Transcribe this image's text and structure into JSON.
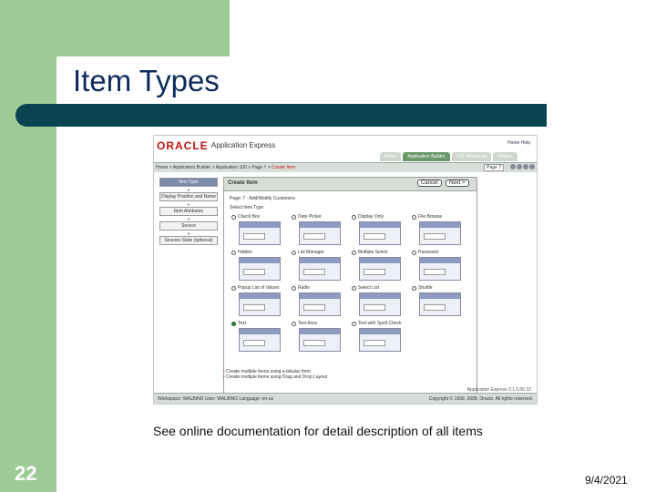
{
  "slide": {
    "title": "Item Types",
    "caption": "See online documentation for detail description of all items",
    "page_number": "22",
    "date": "9/4/2021",
    "colors": {
      "side_green": "#9ccb96",
      "title_bar": "#0b4451",
      "title_text": "#0d2b5a"
    }
  },
  "screenshot": {
    "brand": "ORACLE",
    "product": "Application Express",
    "top_links": [
      "Home",
      "Help"
    ],
    "tabs": [
      {
        "label": "Home",
        "active": false
      },
      {
        "label": "Application Builder",
        "active": true
      },
      {
        "label": "SQL Workshop",
        "active": false
      },
      {
        "label": "Utilities",
        "active": false
      }
    ],
    "breadcrumb": "Home > Application Builder > Application 100 > Page 7 >",
    "breadcrumb_current": "Create Item",
    "page_selector": "Page 7",
    "wizard_steps": [
      {
        "label": "Item Type",
        "current": true
      },
      {
        "label": "Display Position and Name",
        "current": false
      },
      {
        "label": "Item Attributes",
        "current": false
      },
      {
        "label": "Source",
        "current": false
      },
      {
        "label": "Session State (optional)",
        "current": false
      }
    ],
    "panel_title": "Create Item",
    "cancel_label": "Cancel",
    "next_label": "Next >",
    "page_info": "Page: 7 - Add/Modify Customers",
    "select_label": "Select Item Type",
    "item_types": [
      {
        "label": "Check Box",
        "selected": false
      },
      {
        "label": "Date Picker",
        "selected": false
      },
      {
        "label": "Display Only",
        "selected": false
      },
      {
        "label": "File Browse",
        "selected": false
      },
      {
        "label": "Hidden",
        "selected": false
      },
      {
        "label": "List Manager",
        "selected": false
      },
      {
        "label": "Multiple Select",
        "selected": false
      },
      {
        "label": "Password",
        "selected": false
      },
      {
        "label": "Popup List of Values",
        "selected": false
      },
      {
        "label": "Radio",
        "selected": false
      },
      {
        "label": "Select List",
        "selected": false
      },
      {
        "label": "Shuttle",
        "selected": false
      },
      {
        "label": "Text",
        "selected": true
      },
      {
        "label": "Text Area",
        "selected": false
      },
      {
        "label": "Text with Spell Check",
        "selected": false
      }
    ],
    "options": [
      "Create multiple items using a tabular form",
      "Create multiple items using Drag and Drop Layout"
    ],
    "version": "Application Express 3.1.0.00.32",
    "footer_left": "Workspace: WALBINO   User: WALBINO   Language: en-us",
    "footer_right": "Copyright © 1999, 2008, Oracle. All rights reserved."
  }
}
